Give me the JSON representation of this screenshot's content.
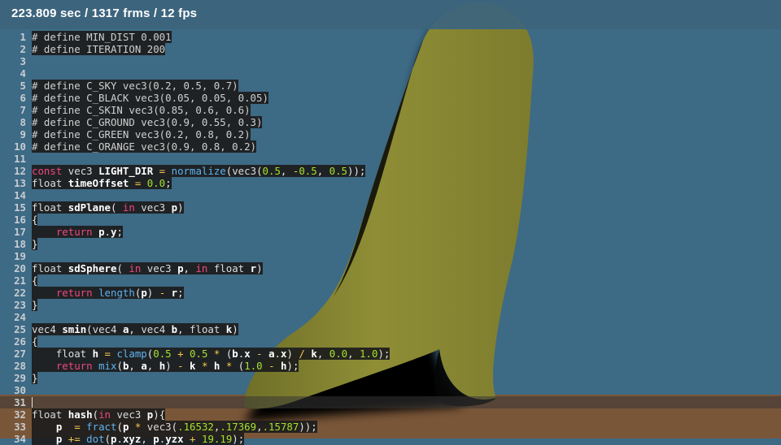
{
  "status": {
    "text": "223.809 sec / 1317 frms / 12 fps"
  },
  "colors": {
    "sky": "#3d6a85",
    "ground": "#7a5638",
    "skin": "#8a8a34",
    "shadow": "#050505"
  },
  "editor": {
    "active_line": 31,
    "lines": [
      {
        "num": "1",
        "segments": [
          [
            "c",
            "# define MIN_DIST 0.001"
          ]
        ]
      },
      {
        "num": "2",
        "segments": [
          [
            "c",
            "# define ITERATION 200"
          ]
        ]
      },
      {
        "num": "3",
        "segments": []
      },
      {
        "num": "4",
        "segments": []
      },
      {
        "num": "5",
        "segments": [
          [
            "c",
            "# define C_SKY vec3(0.2, 0.5, 0.7)"
          ]
        ]
      },
      {
        "num": "6",
        "segments": [
          [
            "c",
            "# define C_BLACK vec3(0.05, 0.05, 0.05)"
          ]
        ]
      },
      {
        "num": "7",
        "segments": [
          [
            "c",
            "# define C_SKIN vec3(0.85, 0.6, 0.6)"
          ]
        ]
      },
      {
        "num": "8",
        "segments": [
          [
            "c",
            "# define C_GROUND vec3(0.9, 0.55, 0.3)"
          ]
        ]
      },
      {
        "num": "9",
        "segments": [
          [
            "c",
            "# define C_GREEN vec3(0.2, 0.8, 0.2)"
          ]
        ]
      },
      {
        "num": "10",
        "segments": [
          [
            "c",
            "# define C_ORANGE vec3(0.9, 0.8, 0.2)"
          ]
        ]
      },
      {
        "num": "11",
        "segments": []
      },
      {
        "num": "12",
        "segments": [
          [
            "k",
            "const"
          ],
          [
            "t",
            " vec3 "
          ],
          [
            "f",
            "LIGHT_DIR"
          ],
          [
            "o",
            " = "
          ],
          [
            "b",
            "normalize"
          ],
          [
            "p",
            "("
          ],
          [
            "t",
            "vec3"
          ],
          [
            "p",
            "("
          ],
          [
            "n",
            "0.5"
          ],
          [
            "p",
            ", "
          ],
          [
            "o",
            "-"
          ],
          [
            "n",
            "0.5"
          ],
          [
            "p",
            ", "
          ],
          [
            "n",
            "0.5"
          ],
          [
            "p",
            "));"
          ]
        ]
      },
      {
        "num": "13",
        "segments": [
          [
            "t",
            "float "
          ],
          [
            "f",
            "timeOffset"
          ],
          [
            "o",
            " = "
          ],
          [
            "n",
            "0.0"
          ],
          [
            "p",
            ";"
          ]
        ]
      },
      {
        "num": "14",
        "segments": []
      },
      {
        "num": "15",
        "segments": [
          [
            "t",
            "float "
          ],
          [
            "f",
            "sdPlane"
          ],
          [
            "p",
            "( "
          ],
          [
            "k",
            "in"
          ],
          [
            "t",
            " vec3 "
          ],
          [
            "f",
            "p"
          ],
          [
            "p",
            ")"
          ]
        ]
      },
      {
        "num": "16",
        "segments": [
          [
            "p",
            "{"
          ]
        ]
      },
      {
        "num": "17",
        "segments": [
          [
            "t",
            "    "
          ],
          [
            "k",
            "return"
          ],
          [
            "t",
            " "
          ],
          [
            "f",
            "p"
          ],
          [
            "p",
            "."
          ],
          [
            "f",
            "y"
          ],
          [
            "p",
            ";"
          ]
        ]
      },
      {
        "num": "18",
        "segments": [
          [
            "p",
            "}"
          ]
        ]
      },
      {
        "num": "19",
        "segments": []
      },
      {
        "num": "20",
        "segments": [
          [
            "t",
            "float "
          ],
          [
            "f",
            "sdSphere"
          ],
          [
            "p",
            "( "
          ],
          [
            "k",
            "in"
          ],
          [
            "t",
            " vec3 "
          ],
          [
            "f",
            "p"
          ],
          [
            "p",
            ", "
          ],
          [
            "k",
            "in"
          ],
          [
            "t",
            " float "
          ],
          [
            "f",
            "r"
          ],
          [
            "p",
            ")"
          ]
        ]
      },
      {
        "num": "21",
        "segments": [
          [
            "p",
            "{"
          ]
        ]
      },
      {
        "num": "22",
        "segments": [
          [
            "t",
            "    "
          ],
          [
            "k",
            "return"
          ],
          [
            "t",
            " "
          ],
          [
            "b",
            "length"
          ],
          [
            "p",
            "("
          ],
          [
            "f",
            "p"
          ],
          [
            "p",
            ")"
          ],
          [
            "o",
            " - "
          ],
          [
            "f",
            "r"
          ],
          [
            "p",
            ";"
          ]
        ]
      },
      {
        "num": "23",
        "segments": [
          [
            "p",
            "}"
          ]
        ]
      },
      {
        "num": "24",
        "segments": []
      },
      {
        "num": "25",
        "segments": [
          [
            "t",
            "vec4 "
          ],
          [
            "f",
            "smin"
          ],
          [
            "p",
            "("
          ],
          [
            "t",
            "vec4 "
          ],
          [
            "f",
            "a"
          ],
          [
            "p",
            ", "
          ],
          [
            "t",
            "vec4 "
          ],
          [
            "f",
            "b"
          ],
          [
            "p",
            ", "
          ],
          [
            "t",
            "float "
          ],
          [
            "f",
            "k"
          ],
          [
            "p",
            ")"
          ]
        ]
      },
      {
        "num": "26",
        "segments": [
          [
            "p",
            "{"
          ]
        ]
      },
      {
        "num": "27",
        "segments": [
          [
            "t",
            "    float "
          ],
          [
            "f",
            "h"
          ],
          [
            "o",
            " = "
          ],
          [
            "b",
            "clamp"
          ],
          [
            "p",
            "("
          ],
          [
            "n",
            "0.5"
          ],
          [
            "o",
            " + "
          ],
          [
            "n",
            "0.5"
          ],
          [
            "o",
            " * "
          ],
          [
            "p",
            "("
          ],
          [
            "f",
            "b"
          ],
          [
            "p",
            "."
          ],
          [
            "f",
            "x"
          ],
          [
            "o",
            " - "
          ],
          [
            "f",
            "a"
          ],
          [
            "p",
            "."
          ],
          [
            "f",
            "x"
          ],
          [
            "p",
            ")"
          ],
          [
            "o",
            " / "
          ],
          [
            "f",
            "k"
          ],
          [
            "p",
            ", "
          ],
          [
            "n",
            "0.0"
          ],
          [
            "p",
            ", "
          ],
          [
            "n",
            "1.0"
          ],
          [
            "p",
            ");"
          ]
        ]
      },
      {
        "num": "28",
        "segments": [
          [
            "t",
            "    "
          ],
          [
            "k",
            "return"
          ],
          [
            "t",
            " "
          ],
          [
            "b",
            "mix"
          ],
          [
            "p",
            "("
          ],
          [
            "f",
            "b"
          ],
          [
            "p",
            ", "
          ],
          [
            "f",
            "a"
          ],
          [
            "p",
            ", "
          ],
          [
            "f",
            "h"
          ],
          [
            "p",
            ")"
          ],
          [
            "o",
            " - "
          ],
          [
            "f",
            "k"
          ],
          [
            "o",
            " * "
          ],
          [
            "f",
            "h"
          ],
          [
            "o",
            " * "
          ],
          [
            "p",
            "("
          ],
          [
            "n",
            "1.0"
          ],
          [
            "o",
            " - "
          ],
          [
            "f",
            "h"
          ],
          [
            "p",
            ");"
          ]
        ]
      },
      {
        "num": "29",
        "segments": [
          [
            "p",
            "}"
          ]
        ]
      },
      {
        "num": "30",
        "segments": []
      },
      {
        "num": "31",
        "segments": []
      },
      {
        "num": "32",
        "segments": [
          [
            "t",
            "float "
          ],
          [
            "f",
            "hash"
          ],
          [
            "p",
            "("
          ],
          [
            "k",
            "in"
          ],
          [
            "t",
            " vec3 "
          ],
          [
            "f",
            "p"
          ],
          [
            "p",
            "){"
          ]
        ]
      },
      {
        "num": "33",
        "segments": [
          [
            "t",
            "    "
          ],
          [
            "f",
            "p"
          ],
          [
            "o",
            "  = "
          ],
          [
            "b",
            "fract"
          ],
          [
            "p",
            "("
          ],
          [
            "f",
            "p"
          ],
          [
            "o",
            " * "
          ],
          [
            "t",
            "vec3"
          ],
          [
            "p",
            "("
          ],
          [
            "n",
            ".16532"
          ],
          [
            "p",
            ","
          ],
          [
            "n",
            ".17369"
          ],
          [
            "p",
            ","
          ],
          [
            "n",
            ".15787"
          ],
          [
            "p",
            "));"
          ]
        ]
      },
      {
        "num": "34",
        "segments": [
          [
            "t",
            "    "
          ],
          [
            "f",
            "p"
          ],
          [
            "o",
            " += "
          ],
          [
            "b",
            "dot"
          ],
          [
            "p",
            "("
          ],
          [
            "f",
            "p"
          ],
          [
            "p",
            "."
          ],
          [
            "f",
            "xyz"
          ],
          [
            "p",
            ", "
          ],
          [
            "f",
            "p"
          ],
          [
            "p",
            "."
          ],
          [
            "f",
            "yzx"
          ],
          [
            "o",
            " + "
          ],
          [
            "n",
            "19.19"
          ],
          [
            "p",
            ");"
          ]
        ]
      }
    ]
  }
}
